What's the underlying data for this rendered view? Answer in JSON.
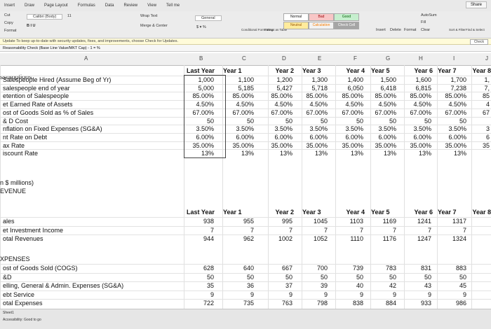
{
  "menu": [
    "Insert",
    "Draw",
    "Page Layout",
    "Formulas",
    "Data",
    "Review",
    "View",
    "Tell me"
  ],
  "share_label": "Share",
  "ribbon": {
    "font_name": "Calibri (Body)",
    "font_size": "11",
    "wrap_text": "Wrap Text",
    "merge_center": "Merge & Center",
    "number_format": "General",
    "conditional": "Conditional Formatting",
    "format_table": "Format as Table",
    "styles": [
      "Normal",
      "Bad",
      "Good",
      "Neutral",
      "Calculation",
      "Check Cell"
    ],
    "insert": "Insert",
    "delete": "Delete",
    "format": "Format",
    "autosum": "AutoSum",
    "fill": "Fill",
    "clear": "Clear",
    "sort_filter": "Sort & Filter",
    "find_select": "Find & Select",
    "cut": "Cut",
    "copy": "Copy",
    "format_painter": "Format"
  },
  "update_bar": {
    "text": "Update   To keep up-to-date with security updates, fixes, and improvements, choose Check for Updates.",
    "button": "Check"
  },
  "formula_bar": "Reasonability Check (Base Line Value/MKT Cap) - 1 = %",
  "columns": [
    "A",
    "B",
    "C",
    "D",
    "E",
    "F",
    "G",
    "H",
    "I",
    "J"
  ],
  "assumptions": {
    "title": "ssumptions:",
    "years": [
      "Last Year",
      "Year 1",
      "Year 2",
      "Year 3",
      "Year 4",
      "Year 5",
      "Year 6",
      "Year 7",
      "Year 8"
    ],
    "rows": [
      {
        "label": "Salespeople Hired (Assume Beg of Yr)",
        "values": [
          "1,000",
          "1,100",
          "1,200",
          "1,300",
          "1,400",
          "1,500",
          "1,600",
          "1,700",
          "1,"
        ]
      },
      {
        "label": "salespeople end of year",
        "values": [
          "5,000",
          "5,185",
          "5,427",
          "5,718",
          "6,050",
          "6,418",
          "6,815",
          "7,238",
          "7,"
        ]
      },
      {
        "label": "etention of Salespeople",
        "values": [
          "85.00%",
          "85.00%",
          "85.00%",
          "85.00%",
          "85.00%",
          "85.00%",
          "85.00%",
          "85.00%",
          "85"
        ]
      },
      {
        "label": "et Earned Rate of Assets",
        "values": [
          "4.50%",
          "4.50%",
          "4.50%",
          "4.50%",
          "4.50%",
          "4.50%",
          "4.50%",
          "4.50%",
          "4"
        ]
      },
      {
        "label": "ost of Goods Sold as % of Sales",
        "values": [
          "67.00%",
          "67.00%",
          "67.00%",
          "67.00%",
          "67.00%",
          "67.00%",
          "67.00%",
          "67.00%",
          "67"
        ]
      },
      {
        "label": "& D Cost",
        "values": [
          "50",
          "50",
          "50",
          "50",
          "50",
          "50",
          "50",
          "50",
          ""
        ]
      },
      {
        "label": "nflation on Fixed Expenses (SG&A)",
        "values": [
          "3.50%",
          "3.50%",
          "3.50%",
          "3.50%",
          "3.50%",
          "3.50%",
          "3.50%",
          "3.50%",
          "3"
        ]
      },
      {
        "label": "nt Rate on Debt",
        "values": [
          "6.00%",
          "6.00%",
          "6.00%",
          "6.00%",
          "6.00%",
          "6.00%",
          "6.00%",
          "6.00%",
          "6"
        ]
      },
      {
        "label": "ax Rate",
        "values": [
          "35.00%",
          "35.00%",
          "35.00%",
          "35.00%",
          "35.00%",
          "35.00%",
          "35.00%",
          "35.00%",
          "35"
        ]
      },
      {
        "label": "iscount Rate",
        "values": [
          "13%",
          "13%",
          "13%",
          "13%",
          "13%",
          "13%",
          "13%",
          "13%",
          ""
        ]
      }
    ]
  },
  "revenue": {
    "title": "n $ millions)",
    "subtitle": "EVENUE",
    "years": [
      "Last Year",
      "Year 1",
      "Year 2",
      "Year 3",
      "Year 4",
      "Year 5",
      "Year 6",
      "Year 7",
      "Year 8"
    ],
    "rows": [
      {
        "label": "ales",
        "values": [
          "938",
          "955",
          "995",
          "1045",
          "1103",
          "1169",
          "1241",
          "1317",
          ""
        ]
      },
      {
        "label": "et Investment Income",
        "values": [
          "7",
          "7",
          "7",
          "7",
          "7",
          "7",
          "7",
          "7",
          ""
        ]
      },
      {
        "label": "otal Revenues",
        "values": [
          "944",
          "962",
          "1002",
          "1052",
          "1110",
          "1176",
          "1247",
          "1324",
          ""
        ]
      }
    ]
  },
  "expenses": {
    "title": "XPENSES",
    "rows": [
      {
        "label": "ost of Goods Sold (COGS)",
        "values": [
          "628",
          "640",
          "667",
          "700",
          "739",
          "783",
          "831",
          "883",
          ""
        ]
      },
      {
        "label": "&D",
        "values": [
          "50",
          "50",
          "50",
          "50",
          "50",
          "50",
          "50",
          "50",
          ""
        ]
      },
      {
        "label": "elling, General & Admin. Expenses (SG&A)",
        "values": [
          "35",
          "36",
          "37",
          "39",
          "40",
          "42",
          "43",
          "45",
          ""
        ]
      },
      {
        "label": "ebt Service",
        "values": [
          "9",
          "9",
          "9",
          "9",
          "9",
          "9",
          "9",
          "9",
          ""
        ]
      },
      {
        "label": "otal Expenses",
        "values": [
          "722",
          "735",
          "763",
          "798",
          "838",
          "884",
          "933",
          "986",
          ""
        ]
      }
    ]
  },
  "sheet_tab": "Sheet1",
  "status": "Accessibility: Good to go"
}
